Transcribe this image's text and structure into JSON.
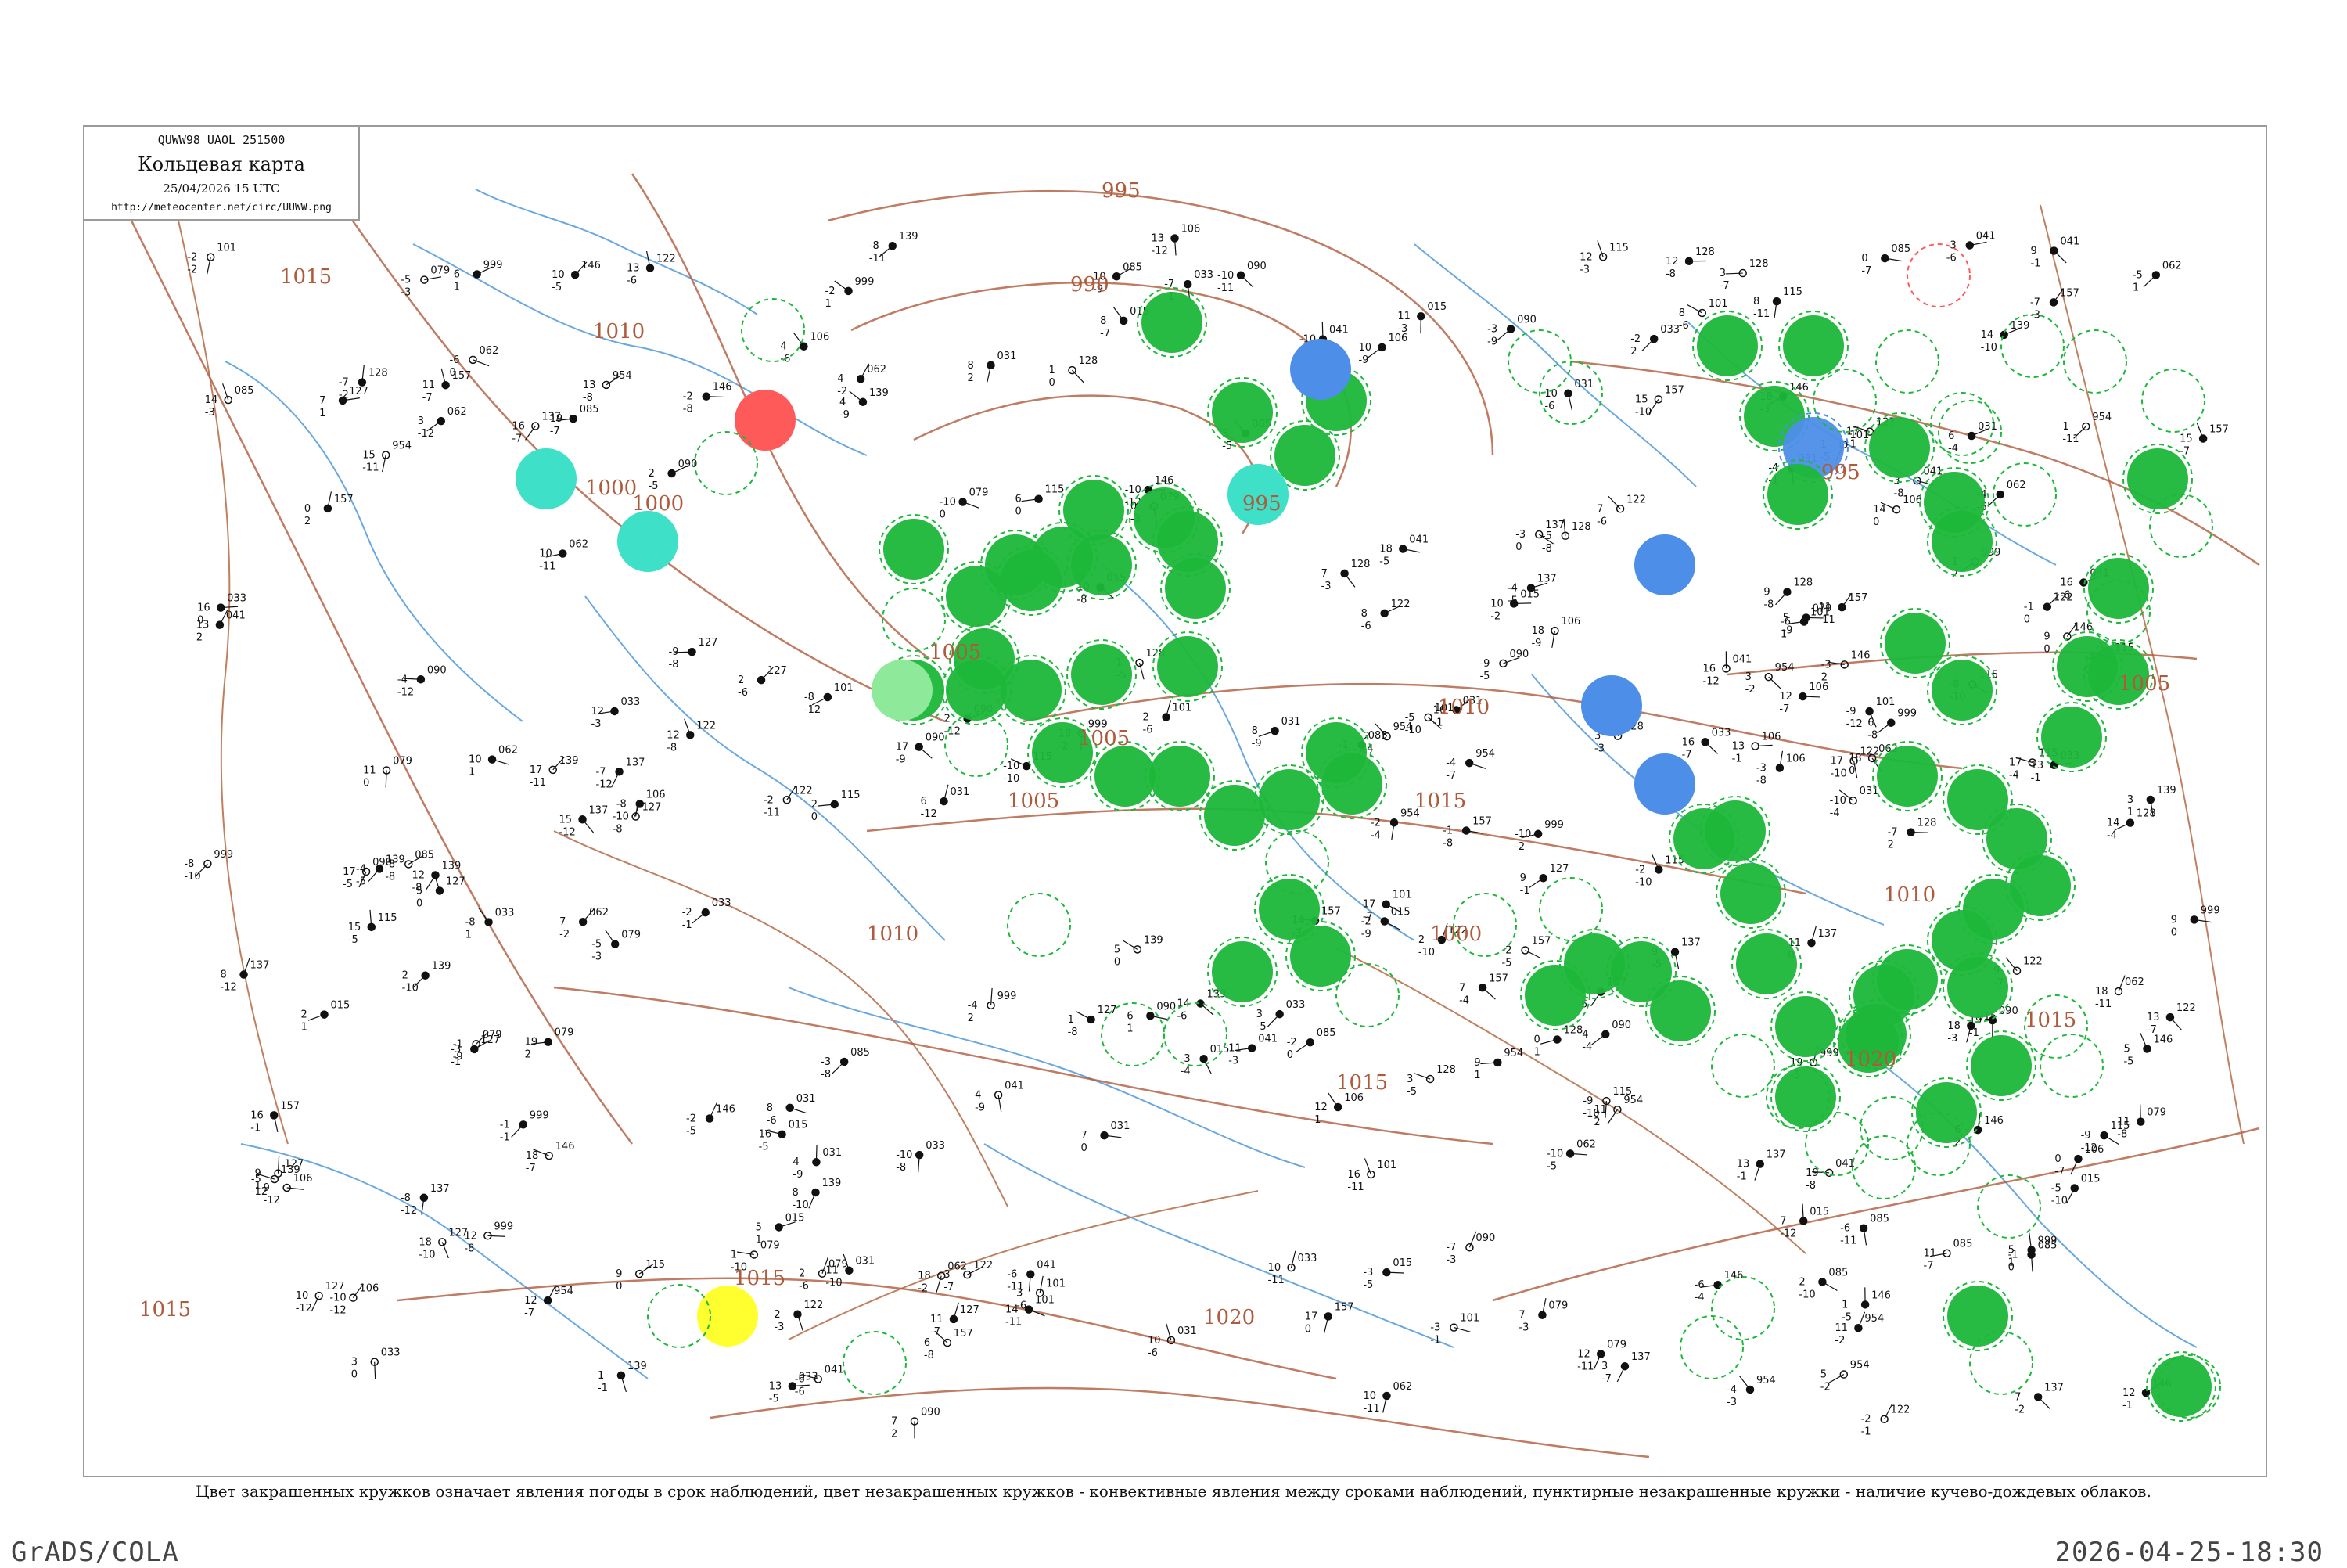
{
  "header": {
    "code": "QUWW98  UAOL  251500",
    "title": "Кольцевая карта",
    "time": "25/04/2026 15 UTC",
    "url": "http://meteocenter.net/circ/UUWW.png"
  },
  "caption": "Цвет закрашенных кружков означает явления погоды в срок наблюдений, цвет незакрашенных кружков - конвективные явления между сроками наблюдений, пунктирные незакрашенные кружки - наличие кучево-дождевых облаков.",
  "footer": {
    "left": "GrADS/COLA",
    "right": "2026-04-25-18:30"
  },
  "colors": {
    "river": "#6aa8e0",
    "border": "#c08060",
    "isobar": "#b05a3c",
    "frame": "#9a9a9a",
    "rain": "#1db83a",
    "shower": "#4d8fe8",
    "fog": "#3fe0c8",
    "drizzle": "#8eea9a",
    "thunder": "#ff5a5a",
    "haze": "#ffff30"
  },
  "isobar_labels": [
    "1015",
    "1010",
    "1005",
    "1000",
    "995",
    "990",
    "995",
    "1000",
    "1005",
    "1010",
    "1015",
    "1020",
    "1015",
    "1010",
    "1005",
    "1000",
    "995",
    "1010",
    "1005",
    "1015",
    "1015",
    "1020",
    "1015"
  ],
  "station_labels": [
    "015",
    "954",
    "031",
    "085",
    "127",
    "101",
    "139",
    "157",
    "106",
    "090",
    "146",
    "115",
    "128",
    "137",
    "122",
    "999",
    "062",
    "033",
    "079",
    "041"
  ],
  "weather_circles": [
    {
      "kind": "rain",
      "dashed": true
    },
    {
      "kind": "rain",
      "dashed": true
    },
    {
      "kind": "rain",
      "dashed": true
    },
    {
      "kind": "shower",
      "dashed": false
    },
    {
      "kind": "fog",
      "dashed": false
    },
    {
      "kind": "thunder",
      "dashed": false
    },
    {
      "kind": "haze",
      "dashed": false
    },
    {
      "kind": "drizzle",
      "dashed": false
    }
  ]
}
